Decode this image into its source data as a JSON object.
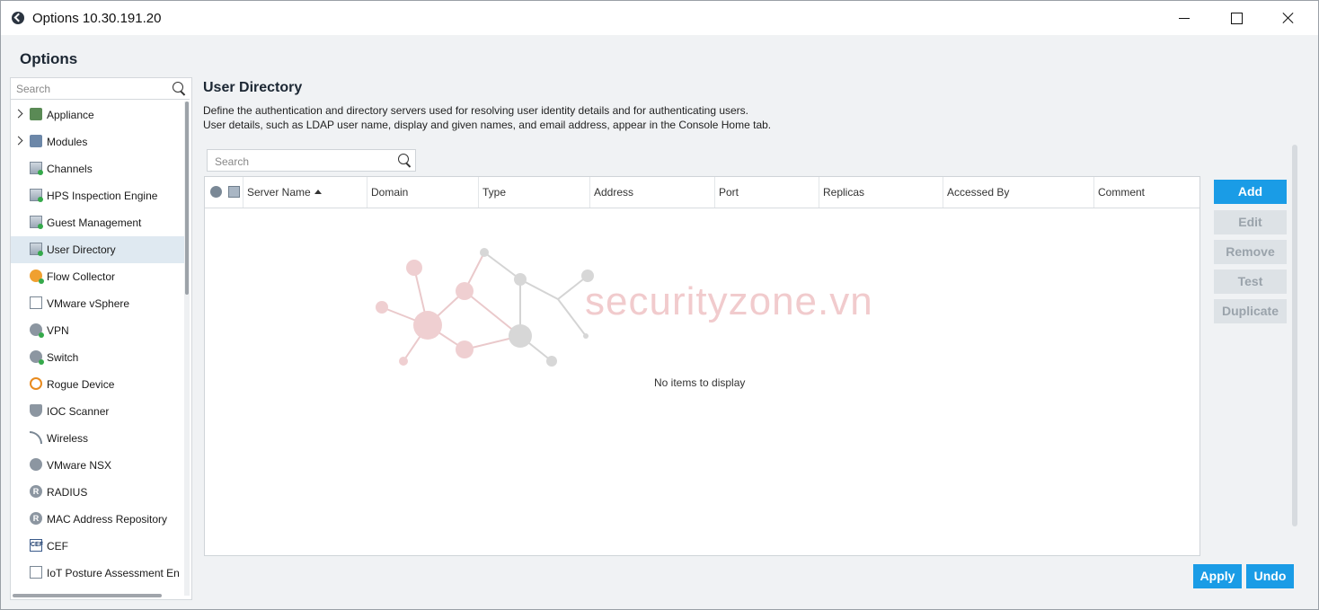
{
  "window": {
    "title": "Options 10.30.191.20"
  },
  "options_heading": "Options",
  "sidebar": {
    "search_placeholder": "Search",
    "items": [
      {
        "label": "Appliance",
        "expandable": true,
        "icon": "appliance-icon"
      },
      {
        "label": "Modules",
        "expandable": true,
        "icon": "modules-icon"
      },
      {
        "label": "Channels",
        "icon": "channels-icon"
      },
      {
        "label": "HPS Inspection Engine",
        "icon": "hps-inspection-icon"
      },
      {
        "label": "Guest Management",
        "icon": "guest-management-icon"
      },
      {
        "label": "User Directory",
        "icon": "user-directory-icon",
        "selected": true
      },
      {
        "label": "Flow Collector",
        "icon": "flow-collector-icon"
      },
      {
        "label": "VMware vSphere",
        "icon": "vmware-vsphere-icon"
      },
      {
        "label": "VPN",
        "icon": "vpn-icon"
      },
      {
        "label": "Switch",
        "icon": "switch-icon"
      },
      {
        "label": "Rogue Device",
        "icon": "rogue-device-icon"
      },
      {
        "label": "IOC Scanner",
        "icon": "ioc-scanner-icon"
      },
      {
        "label": "Wireless",
        "icon": "wireless-icon"
      },
      {
        "label": "VMware NSX",
        "icon": "vmware-nsx-icon"
      },
      {
        "label": "RADIUS",
        "icon": "radius-icon"
      },
      {
        "label": "MAC Address Repository",
        "icon": "mac-repository-icon"
      },
      {
        "label": "CEF",
        "icon": "cef-icon"
      },
      {
        "label": "IoT Posture Assessment En",
        "icon": "iot-posture-icon"
      }
    ]
  },
  "main": {
    "title": "User Directory",
    "description_line1": "Define the authentication and directory servers used for resolving user identity details and for authenticating users.",
    "description_line2": "User details, such as LDAP user name, display and given names, and email address, appear in the Console Home tab.",
    "search_placeholder": "Search",
    "columns": [
      "Server Name",
      "Domain",
      "Type",
      "Address",
      "Port",
      "Replicas",
      "Accessed By",
      "Comment"
    ],
    "sort_column": "Server Name",
    "empty_text": "No items to display",
    "watermark_text": "securityzone.vn"
  },
  "buttons": {
    "add": "Add",
    "edit": "Edit",
    "remove": "Remove",
    "test": "Test",
    "duplicate": "Duplicate",
    "apply": "Apply",
    "undo": "Undo"
  },
  "colors": {
    "accent": "#1a9ce6",
    "selected_row": "#dfe9f1",
    "disabled_button": "#dde2e6",
    "watermark": "#f1c9cb"
  }
}
